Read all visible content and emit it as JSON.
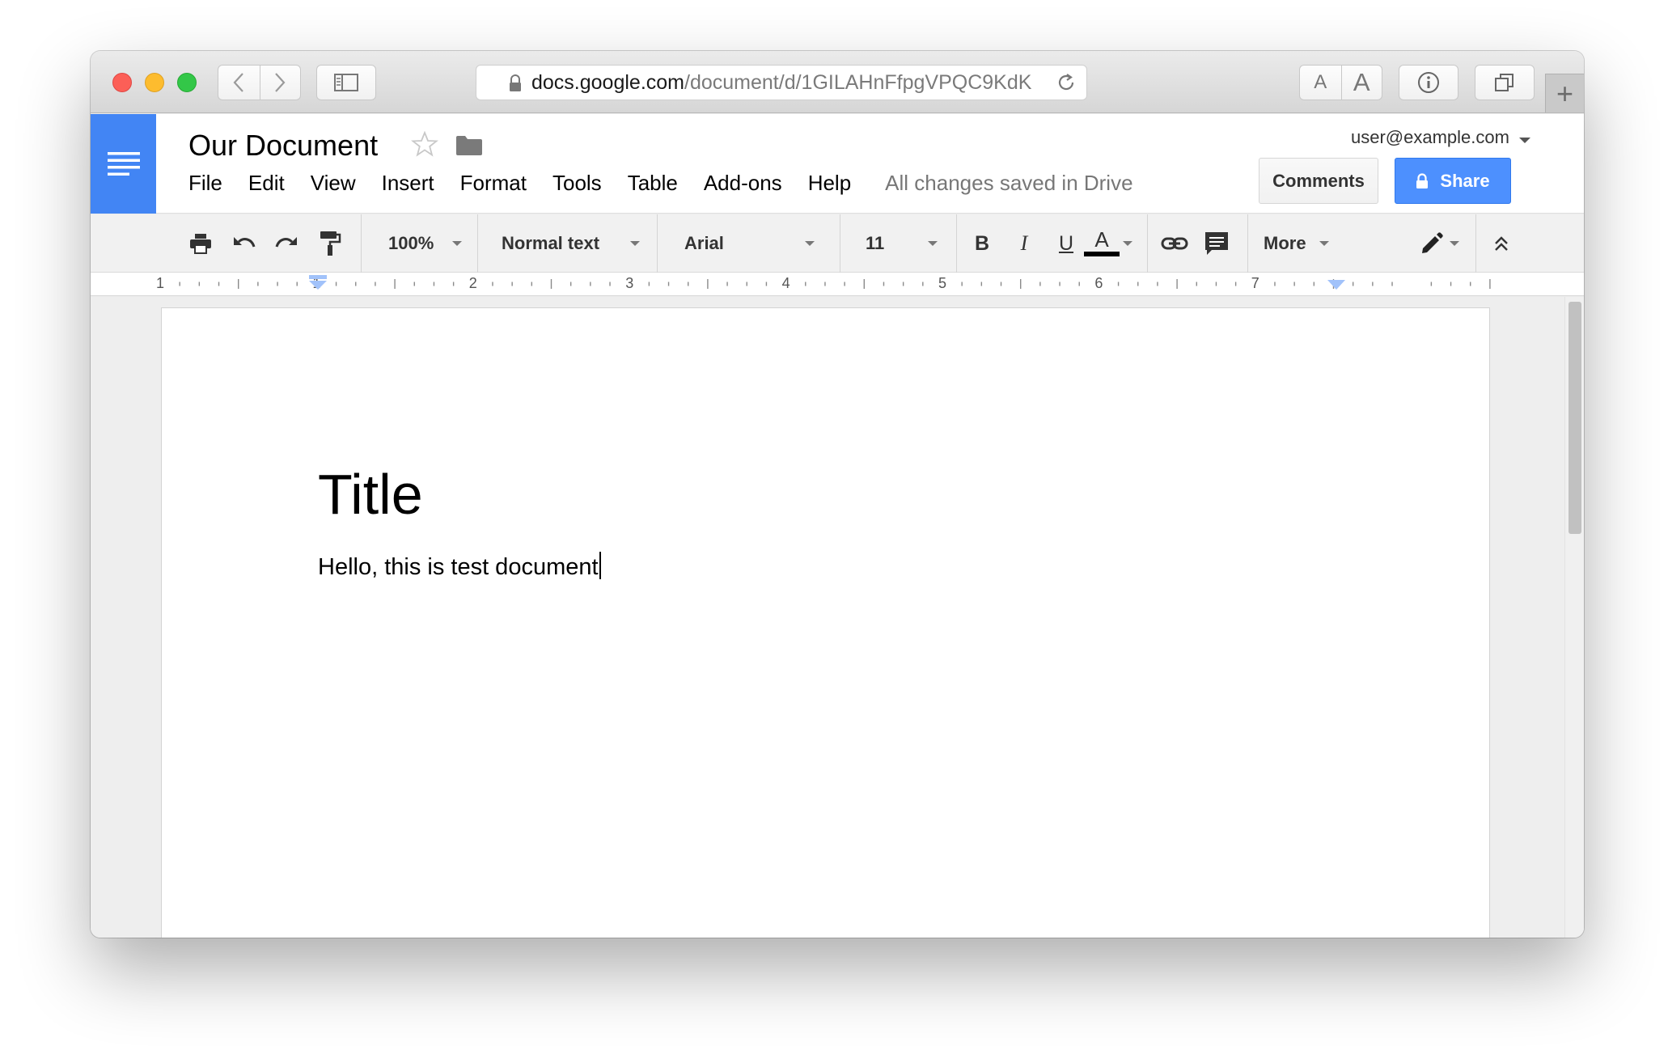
{
  "browser": {
    "url_domain": "docs.google.com",
    "url_path": "/document/d/1GILAHnFfpgVPQC9KdK",
    "text_size_small": "A",
    "text_size_large": "A",
    "new_tab": "+"
  },
  "header": {
    "doc_title": "Our Document",
    "user_email": "user@example.com",
    "menu": [
      "File",
      "Edit",
      "View",
      "Insert",
      "Format",
      "Tools",
      "Table",
      "Add-ons",
      "Help"
    ],
    "save_status": "All changes saved in Drive",
    "comments_label": "Comments",
    "share_label": "Share"
  },
  "toolbar": {
    "zoom": "100%",
    "style": "Normal text",
    "font": "Arial",
    "font_size": "11",
    "bold": "B",
    "italic": "I",
    "underline": "U",
    "text_color": "A",
    "more": "More"
  },
  "ruler": {
    "numbers": [
      "1",
      "1",
      "2",
      "3",
      "4",
      "5",
      "6",
      "7"
    ]
  },
  "document": {
    "title": "Title",
    "body": "Hello, this is test document"
  },
  "colors": {
    "docs_blue": "#4285f4",
    "share_blue": "#4d90fe",
    "ruler_marker": "#a1c2fa"
  }
}
